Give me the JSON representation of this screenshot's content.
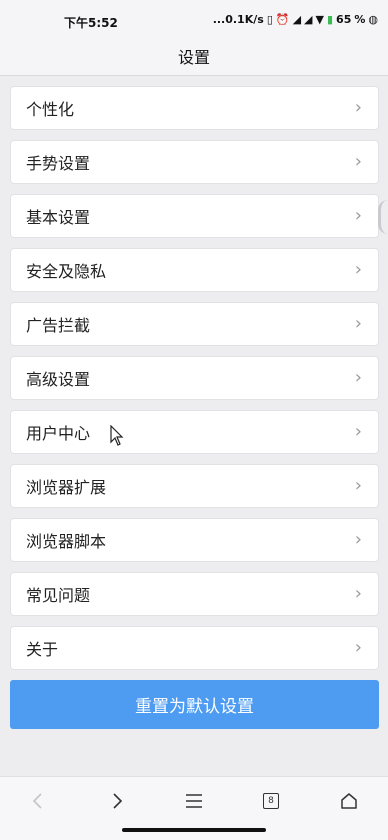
{
  "status": {
    "time": "下午5:52",
    "network_speed": "...0.1K/s",
    "battery": "65",
    "percent": "%"
  },
  "header": {
    "title": "设置"
  },
  "menu": {
    "items": [
      {
        "label": "个性化"
      },
      {
        "label": "手势设置"
      },
      {
        "label": "基本设置"
      },
      {
        "label": "安全及隐私"
      },
      {
        "label": "广告拦截"
      },
      {
        "label": "高级设置"
      },
      {
        "label": "用户中心"
      },
      {
        "label": "浏览器扩展"
      },
      {
        "label": "浏览器脚本"
      },
      {
        "label": "常见问题"
      },
      {
        "label": "关于"
      }
    ]
  },
  "reset_button": {
    "label": "重置为默认设置"
  },
  "bottom_nav": {
    "tabs_count": "8",
    "icons": [
      "back-icon",
      "forward-icon",
      "menu-icon",
      "tabs-icon",
      "home-icon"
    ]
  },
  "colors": {
    "accent": "#4e9cf2",
    "background": "#ededf0",
    "card": "#ffffff"
  }
}
